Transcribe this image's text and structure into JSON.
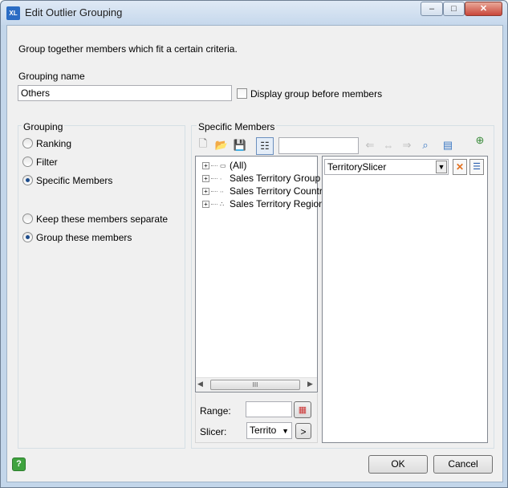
{
  "window": {
    "title": "Edit Outlier Grouping",
    "app_icon_text": "XL",
    "minimize": "–",
    "maximize": "□",
    "close": "✕"
  },
  "intro_text": "Group together members which fit a certain criteria.",
  "grouping_name": {
    "label": "Grouping name",
    "value": "Others",
    "display_before_label": "Display group before members",
    "display_before_checked": false
  },
  "grouping": {
    "title": "Grouping",
    "options": [
      "Ranking",
      "Filter",
      "Specific Members"
    ],
    "selected": "Specific Members",
    "separate_options": [
      "Keep these members separate",
      "Group these members"
    ],
    "separate_selected": "Group these members"
  },
  "specific_members": {
    "title": "Specific Members",
    "search_value": "",
    "tree": [
      {
        "label": "(All)",
        "level_icon": "▭"
      },
      {
        "label": "Sales Territory Group",
        "level_icon": "∙"
      },
      {
        "label": "Sales Territory Country",
        "level_icon": "∙∙"
      },
      {
        "label": "Sales Territory Region",
        "level_icon": "∴"
      }
    ],
    "scroll_thumb": "III",
    "range_label": "Range:",
    "range_value": "",
    "slicer_label": "Slicer:",
    "slicer_value": "Territo",
    "slicer_go": ">",
    "selected_dropdown_value": "TerritorySlicer"
  },
  "footer": {
    "help_icon": "?",
    "ok": "OK",
    "cancel": "Cancel"
  }
}
